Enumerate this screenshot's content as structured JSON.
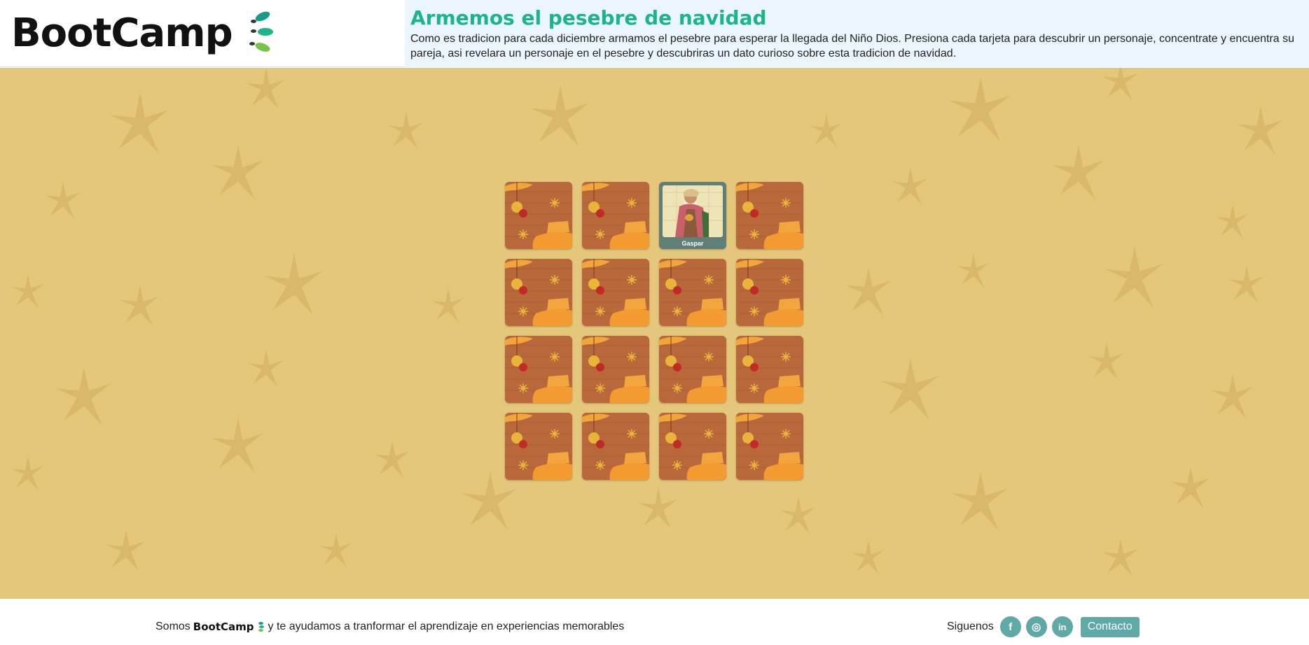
{
  "brand": {
    "name": "BootCamp"
  },
  "header": {
    "title": "Armemos el pesebre de navidad",
    "description": "Como es tradicion para cada diciembre armamos el pesebre para esperar la llegada del Niño Dios. Presiona cada tarjeta para descubrir un personaje, concentrate y encuentra su pareja, asi revelara un personaje en el pesebre y descubriras un dato curioso sobre esta tradicion de navidad."
  },
  "board": {
    "cards": [
      {
        "state": "hidden"
      },
      {
        "state": "hidden"
      },
      {
        "state": "revealed",
        "caption": "Gaspar"
      },
      {
        "state": "hidden"
      },
      {
        "state": "hidden"
      },
      {
        "state": "hidden"
      },
      {
        "state": "hidden"
      },
      {
        "state": "hidden"
      },
      {
        "state": "hidden"
      },
      {
        "state": "hidden"
      },
      {
        "state": "hidden"
      },
      {
        "state": "hidden"
      },
      {
        "state": "hidden"
      },
      {
        "state": "hidden"
      },
      {
        "state": "hidden"
      },
      {
        "state": "hidden"
      }
    ]
  },
  "footer": {
    "prefix": "Somos",
    "brand": "BootCamp",
    "suffix": "y te ayudamos a tranformar el aprendizaje en experiencias memorables",
    "follow_label": "Siguenos",
    "social": [
      {
        "icon": "facebook-icon",
        "glyph": "f"
      },
      {
        "icon": "instagram-icon",
        "glyph": "◎"
      },
      {
        "icon": "linkedin-icon",
        "glyph": "in"
      }
    ],
    "contact_label": "Contacto"
  },
  "colors": {
    "title": "#1bb588",
    "background": "#e5c77b",
    "card": "#b8683a",
    "social": "#5fa9a6"
  }
}
